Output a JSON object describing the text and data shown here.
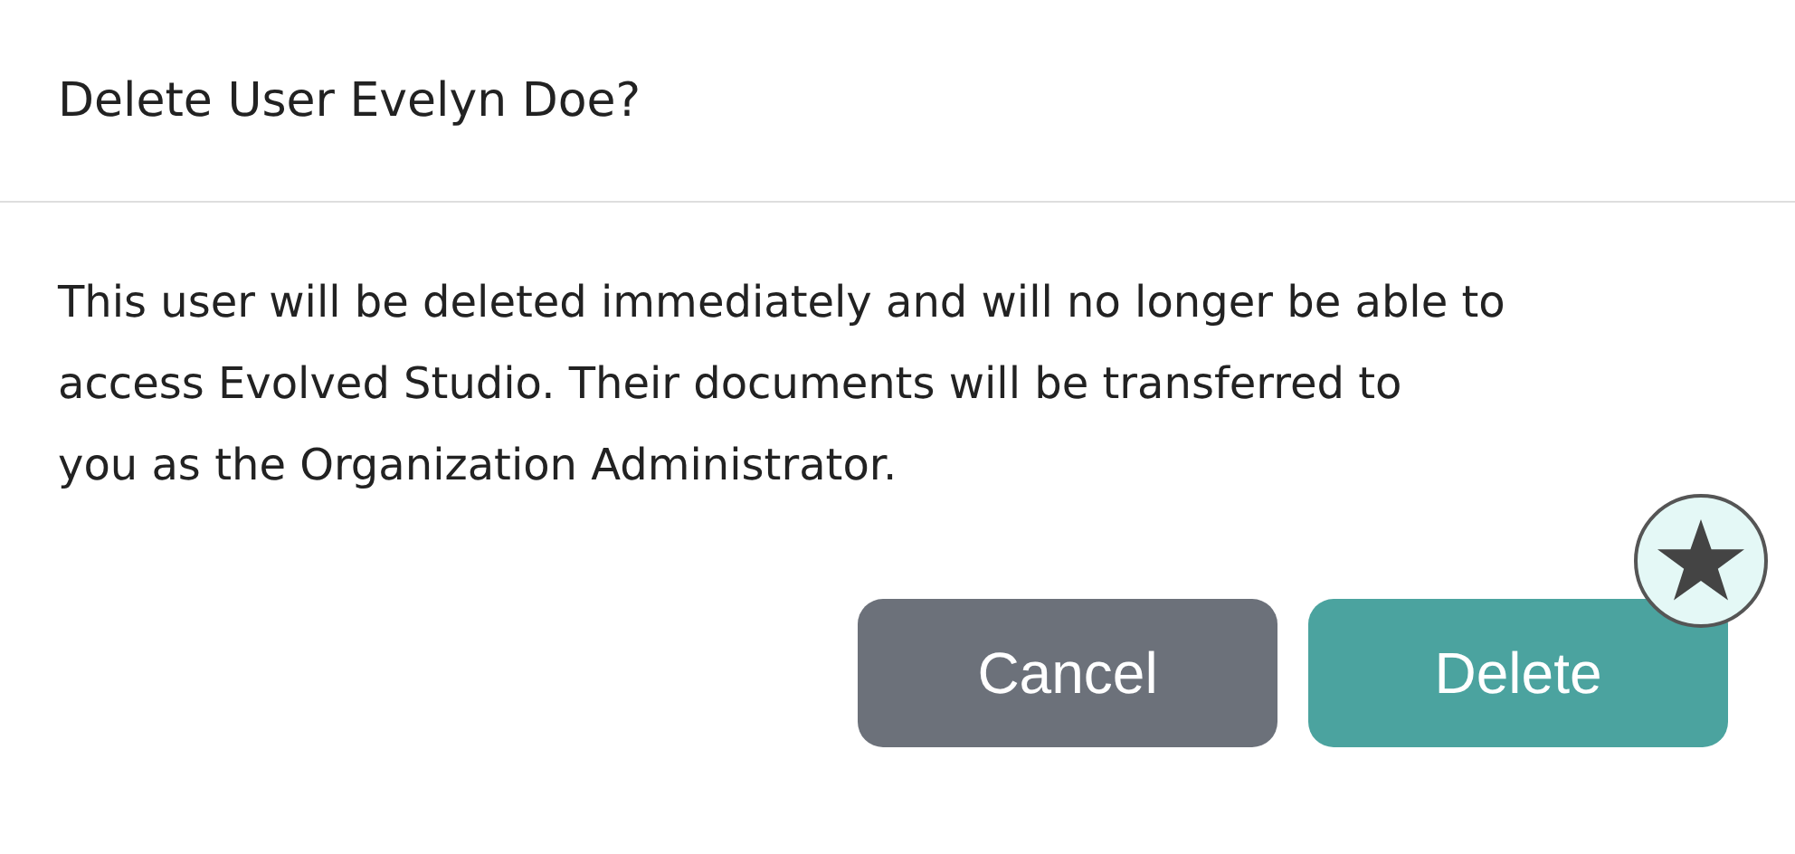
{
  "dialog": {
    "title": "Delete User Evelyn Doe?",
    "message_lines": [
      "This user will be deleted immediately and will no longer be able to",
      "access Evolved Studio. Their documents will be transferred to",
      "you as the Organization Administrator."
    ],
    "buttons": [
      {
        "label": "Cancel",
        "kind": "secondary"
      },
      {
        "label": "Delete",
        "kind": "primary"
      }
    ]
  }
}
